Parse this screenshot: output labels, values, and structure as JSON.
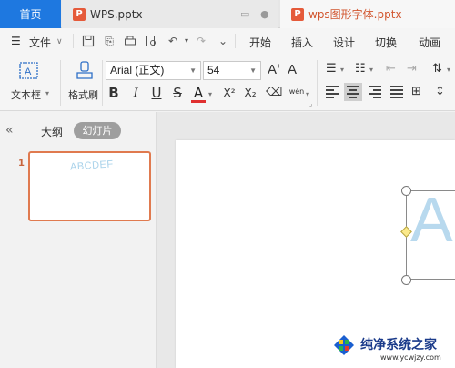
{
  "tabs": {
    "home": "首页",
    "doc1": "WPS.pptx",
    "doc2": "wps图形字体.pptx",
    "ppt_icon": "P"
  },
  "menu": {
    "file": "文件",
    "items": [
      "开始",
      "插入",
      "设计",
      "切换",
      "动画"
    ]
  },
  "ribbon": {
    "textbox_label": "文本框",
    "format_painter_label": "格式刷",
    "font_name": "Arial (正文)",
    "font_size": "54",
    "bold": "B",
    "italic": "I",
    "underline": "U",
    "strike": "S",
    "font_color": "A",
    "superscript": "X²",
    "subscript": "X₂",
    "phonetic": "wén"
  },
  "panel": {
    "outline_tab": "大纲",
    "slides_tab": "幻灯片",
    "slide_number": "1",
    "thumb_text": "ABCDEF"
  },
  "canvas": {
    "big_letter": "A"
  },
  "watermark": {
    "title": "纯净系统之家",
    "url": "www.ycwjzy.com"
  },
  "colors": {
    "accent_blue": "#1e78e0",
    "tab_orange": "#d2562f",
    "thumb_border": "#e07a4f",
    "text_light_blue": "#b8d9ee"
  }
}
